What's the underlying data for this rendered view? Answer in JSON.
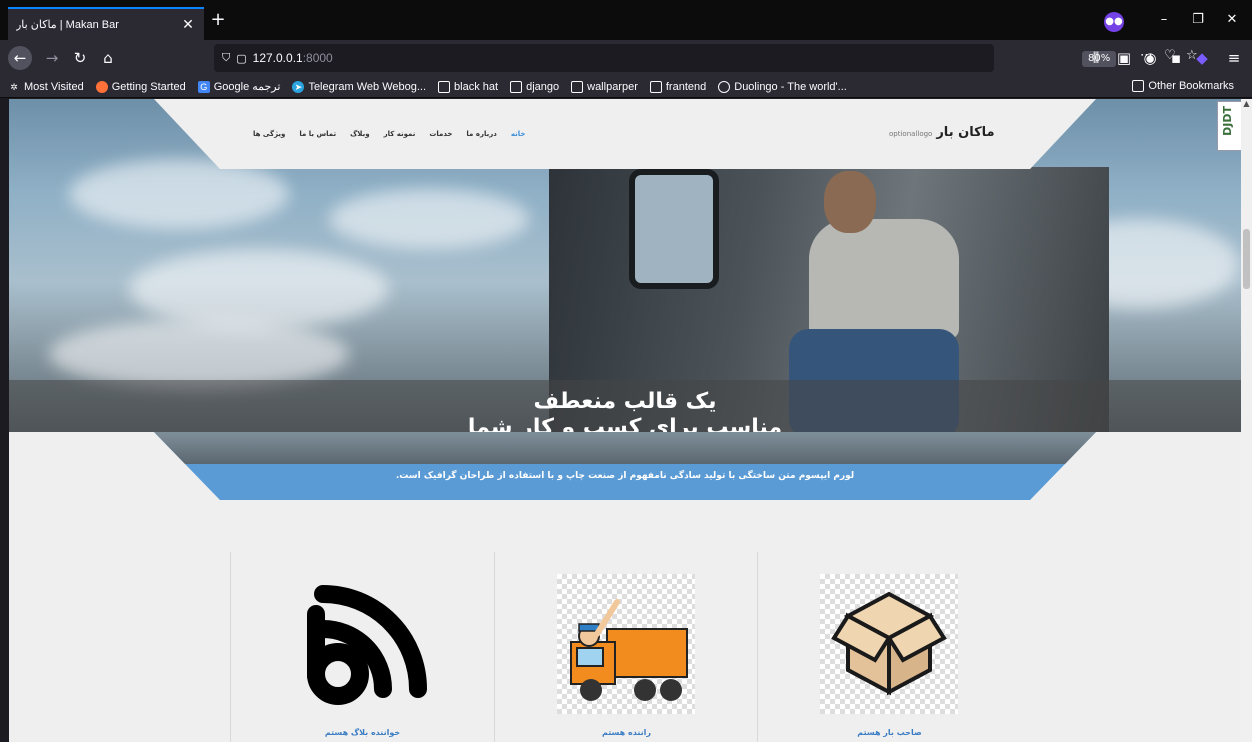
{
  "browser": {
    "tab_title": "ماکان بار | Makan Bar",
    "url_host": "127.0.0.1",
    "url_port": ":8000",
    "zoom": "80%",
    "bookmarks": [
      {
        "label": "Most Visited",
        "icon": "gear-icon",
        "color": "#fbfbfe"
      },
      {
        "label": "Getting Started",
        "icon": "firefox-icon",
        "color": "#ff7139"
      },
      {
        "label": "Google ترجمه",
        "icon": "translate-icon",
        "color": "#4285f4"
      },
      {
        "label": "Telegram Web Webog...",
        "icon": "telegram-icon",
        "color": "#2aa3df"
      },
      {
        "label": "black hat",
        "icon": "folder-icon",
        "color": ""
      },
      {
        "label": "django",
        "icon": "folder-icon",
        "color": ""
      },
      {
        "label": "wallparper",
        "icon": "folder-icon",
        "color": ""
      },
      {
        "label": "frantend",
        "icon": "folder-icon",
        "color": ""
      },
      {
        "label": "Duolingo - The world'...",
        "icon": "globe-icon",
        "color": ""
      }
    ],
    "other_bookmarks": "Other Bookmarks"
  },
  "site": {
    "logo_main": "ماکان بار",
    "logo_sub": "optionallogo",
    "menu": [
      {
        "label": "خانه",
        "active": true
      },
      {
        "label": "درباره ما",
        "active": false
      },
      {
        "label": "خدمات",
        "active": false
      },
      {
        "label": "نمونه کار",
        "active": false
      },
      {
        "label": "وبلاگ",
        "active": false
      },
      {
        "label": "تماس با ما",
        "active": false
      },
      {
        "label": "ویژگی ها",
        "active": false
      }
    ],
    "hero_line1": "یک قالب منعطف",
    "hero_line2": "مناسب برای کسب و کار شما",
    "ribbon_text": "لورم ایپسوم متن ساختگی با تولید سادگی نامفهوم از صنعت چاپ و با استفاده از طراحان گرافیک است.",
    "cards": [
      {
        "label": "خواننده بلاگ هستم",
        "icon": "blogger-icon"
      },
      {
        "label": "راننده هستم",
        "icon": "truck-driver-icon"
      },
      {
        "label": "صاحب بار هستم",
        "icon": "box-icon"
      }
    ],
    "debug_toolbar": "DJDT",
    "accent": "#3b8fd9"
  }
}
